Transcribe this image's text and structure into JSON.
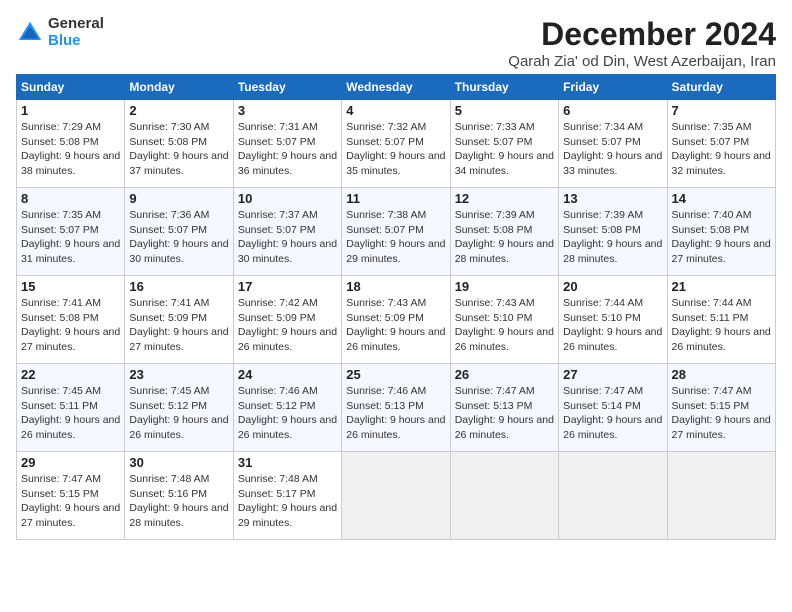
{
  "logo": {
    "general": "General",
    "blue": "Blue"
  },
  "title": "December 2024",
  "location": "Qarah Zia' od Din, West Azerbaijan, Iran",
  "days_header": [
    "Sunday",
    "Monday",
    "Tuesday",
    "Wednesday",
    "Thursday",
    "Friday",
    "Saturday"
  ],
  "weeks": [
    [
      {
        "day": "1",
        "sunrise": "7:29 AM",
        "sunset": "5:08 PM",
        "daylight": "9 hours and 38 minutes."
      },
      {
        "day": "2",
        "sunrise": "7:30 AM",
        "sunset": "5:08 PM",
        "daylight": "9 hours and 37 minutes."
      },
      {
        "day": "3",
        "sunrise": "7:31 AM",
        "sunset": "5:07 PM",
        "daylight": "9 hours and 36 minutes."
      },
      {
        "day": "4",
        "sunrise": "7:32 AM",
        "sunset": "5:07 PM",
        "daylight": "9 hours and 35 minutes."
      },
      {
        "day": "5",
        "sunrise": "7:33 AM",
        "sunset": "5:07 PM",
        "daylight": "9 hours and 34 minutes."
      },
      {
        "day": "6",
        "sunrise": "7:34 AM",
        "sunset": "5:07 PM",
        "daylight": "9 hours and 33 minutes."
      },
      {
        "day": "7",
        "sunrise": "7:35 AM",
        "sunset": "5:07 PM",
        "daylight": "9 hours and 32 minutes."
      }
    ],
    [
      {
        "day": "8",
        "sunrise": "7:35 AM",
        "sunset": "5:07 PM",
        "daylight": "9 hours and 31 minutes."
      },
      {
        "day": "9",
        "sunrise": "7:36 AM",
        "sunset": "5:07 PM",
        "daylight": "9 hours and 30 minutes."
      },
      {
        "day": "10",
        "sunrise": "7:37 AM",
        "sunset": "5:07 PM",
        "daylight": "9 hours and 30 minutes."
      },
      {
        "day": "11",
        "sunrise": "7:38 AM",
        "sunset": "5:07 PM",
        "daylight": "9 hours and 29 minutes."
      },
      {
        "day": "12",
        "sunrise": "7:39 AM",
        "sunset": "5:08 PM",
        "daylight": "9 hours and 28 minutes."
      },
      {
        "day": "13",
        "sunrise": "7:39 AM",
        "sunset": "5:08 PM",
        "daylight": "9 hours and 28 minutes."
      },
      {
        "day": "14",
        "sunrise": "7:40 AM",
        "sunset": "5:08 PM",
        "daylight": "9 hours and 27 minutes."
      }
    ],
    [
      {
        "day": "15",
        "sunrise": "7:41 AM",
        "sunset": "5:08 PM",
        "daylight": "9 hours and 27 minutes."
      },
      {
        "day": "16",
        "sunrise": "7:41 AM",
        "sunset": "5:09 PM",
        "daylight": "9 hours and 27 minutes."
      },
      {
        "day": "17",
        "sunrise": "7:42 AM",
        "sunset": "5:09 PM",
        "daylight": "9 hours and 26 minutes."
      },
      {
        "day": "18",
        "sunrise": "7:43 AM",
        "sunset": "5:09 PM",
        "daylight": "9 hours and 26 minutes."
      },
      {
        "day": "19",
        "sunrise": "7:43 AM",
        "sunset": "5:10 PM",
        "daylight": "9 hours and 26 minutes."
      },
      {
        "day": "20",
        "sunrise": "7:44 AM",
        "sunset": "5:10 PM",
        "daylight": "9 hours and 26 minutes."
      },
      {
        "day": "21",
        "sunrise": "7:44 AM",
        "sunset": "5:11 PM",
        "daylight": "9 hours and 26 minutes."
      }
    ],
    [
      {
        "day": "22",
        "sunrise": "7:45 AM",
        "sunset": "5:11 PM",
        "daylight": "9 hours and 26 minutes."
      },
      {
        "day": "23",
        "sunrise": "7:45 AM",
        "sunset": "5:12 PM",
        "daylight": "9 hours and 26 minutes."
      },
      {
        "day": "24",
        "sunrise": "7:46 AM",
        "sunset": "5:12 PM",
        "daylight": "9 hours and 26 minutes."
      },
      {
        "day": "25",
        "sunrise": "7:46 AM",
        "sunset": "5:13 PM",
        "daylight": "9 hours and 26 minutes."
      },
      {
        "day": "26",
        "sunrise": "7:47 AM",
        "sunset": "5:13 PM",
        "daylight": "9 hours and 26 minutes."
      },
      {
        "day": "27",
        "sunrise": "7:47 AM",
        "sunset": "5:14 PM",
        "daylight": "9 hours and 26 minutes."
      },
      {
        "day": "28",
        "sunrise": "7:47 AM",
        "sunset": "5:15 PM",
        "daylight": "9 hours and 27 minutes."
      }
    ],
    [
      {
        "day": "29",
        "sunrise": "7:47 AM",
        "sunset": "5:15 PM",
        "daylight": "9 hours and 27 minutes."
      },
      {
        "day": "30",
        "sunrise": "7:48 AM",
        "sunset": "5:16 PM",
        "daylight": "9 hours and 28 minutes."
      },
      {
        "day": "31",
        "sunrise": "7:48 AM",
        "sunset": "5:17 PM",
        "daylight": "9 hours and 29 minutes."
      },
      null,
      null,
      null,
      null
    ]
  ],
  "labels": {
    "sunrise": "Sunrise:",
    "sunset": "Sunset:",
    "daylight": "Daylight:"
  }
}
